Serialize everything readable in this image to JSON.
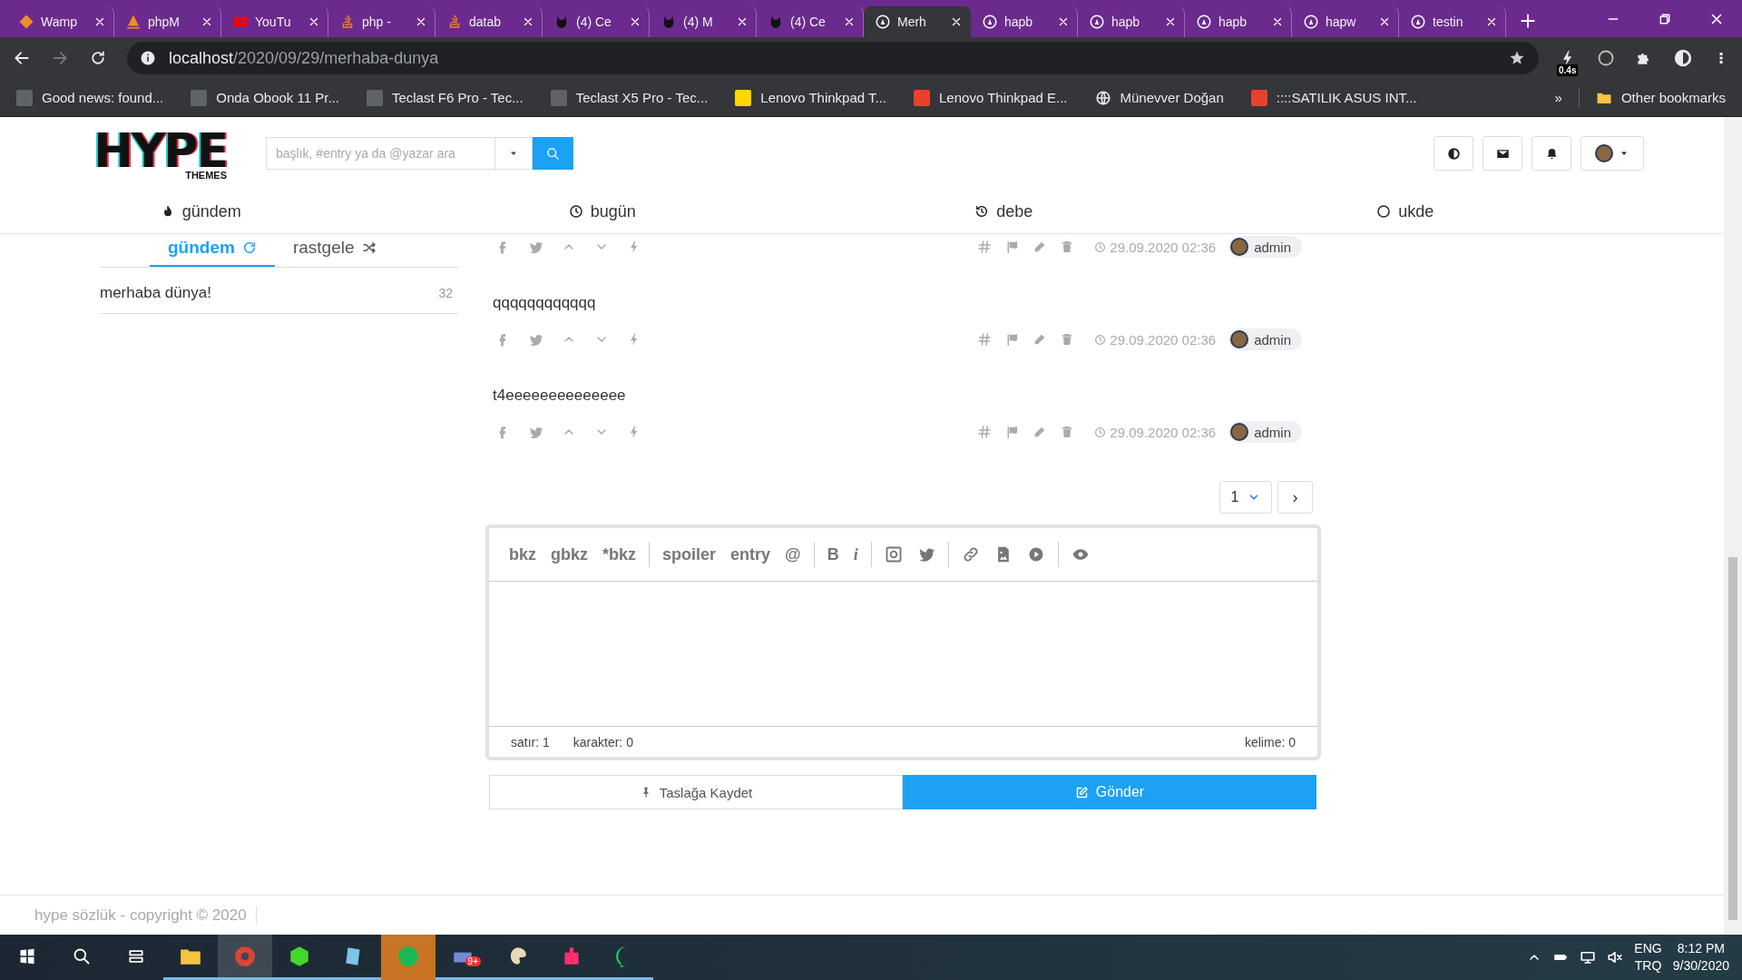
{
  "browser": {
    "tabs": [
      {
        "title": "Wamp",
        "kind": "diamond",
        "selected": false
      },
      {
        "title": "phpM",
        "kind": "sail",
        "selected": false
      },
      {
        "title": "YouTu",
        "kind": "play",
        "selected": false
      },
      {
        "title": "php -",
        "kind": "stack",
        "selected": false
      },
      {
        "title": "datab",
        "kind": "stack",
        "selected": false
      },
      {
        "title": "(4) Ce",
        "kind": "figure",
        "selected": false
      },
      {
        "title": "(4) M",
        "kind": "figure",
        "selected": false
      },
      {
        "title": "(4) Ce",
        "kind": "figure",
        "selected": false
      },
      {
        "title": "Merh",
        "kind": "ring",
        "selected": true
      },
      {
        "title": "hapb",
        "kind": "ring",
        "selected": false
      },
      {
        "title": "hapb",
        "kind": "ring",
        "selected": false
      },
      {
        "title": "hapb",
        "kind": "ring",
        "selected": false
      },
      {
        "title": "hapw",
        "kind": "ring",
        "selected": false
      },
      {
        "title": "testin",
        "kind": "ring",
        "selected": false
      }
    ],
    "address": {
      "host": "localhost",
      "path": "/2020/09/29/merhaba-dunya"
    },
    "extension_badge": "0.4s",
    "bookmarks": [
      {
        "label": "Good news: found...",
        "kind": "grey"
      },
      {
        "label": "Onda Obook 11 Pr...",
        "kind": "grey"
      },
      {
        "label": "Teclast F6 Pro - Tec...",
        "kind": "grey"
      },
      {
        "label": "Teclast X5 Pro - Tec...",
        "kind": "grey"
      },
      {
        "label": "Lenovo Thinkpad T...",
        "kind": "yellow"
      },
      {
        "label": "Lenovo Thinkpad E...",
        "kind": "red"
      },
      {
        "label": "Münevver Doğan",
        "kind": "globe"
      },
      {
        "label": "::::SATILIK ASUS INT...",
        "kind": "red"
      }
    ],
    "bookmarks_overflow": "»",
    "other_bookmarks": "Other bookmarks"
  },
  "site": {
    "logo": {
      "title": "HYPE",
      "subtitle": "THEMES"
    },
    "search": {
      "placeholder": "başlık, #entry ya da @yazar ara"
    },
    "nav": [
      {
        "label": "gündem",
        "kind": "fire"
      },
      {
        "label": "bugün",
        "kind": "clock"
      },
      {
        "label": "debe",
        "kind": "history"
      },
      {
        "label": "ukde",
        "kind": "circle"
      }
    ],
    "sidebar": {
      "tabs": [
        {
          "label": "gündem",
          "kind": "refresh",
          "selected": true
        },
        {
          "label": "rastgele",
          "kind": "shuffle",
          "selected": false
        }
      ],
      "topics": [
        {
          "title": "merhaba dünya!",
          "count": "32"
        }
      ]
    },
    "entries": [
      {
        "date": "29.09.2020 02:36",
        "author": "admin"
      },
      {
        "text": "qqqqqqqqqqqq",
        "date": "29.09.2020 02:36",
        "author": "admin"
      },
      {
        "text": "t4eeeeeeeeeeeeee",
        "date": "29.09.2020 02:36",
        "author": "admin"
      }
    ],
    "pagination": {
      "page": "1",
      "next": "›"
    },
    "editor": {
      "toolbar": [
        [
          {
            "kind": "text",
            "label": "bkz"
          },
          {
            "kind": "text",
            "label": "gbkz"
          },
          {
            "kind": "text",
            "label": "*bkz"
          }
        ],
        [
          {
            "kind": "text",
            "label": "spoiler"
          },
          {
            "kind": "text",
            "label": "entry"
          },
          {
            "kind": "text",
            "label": "@"
          }
        ],
        [
          {
            "kind": "text",
            "label": "B"
          },
          {
            "kind": "italic",
            "label": "i"
          }
        ],
        [
          {
            "kind": "camera"
          },
          {
            "kind": "bird"
          }
        ],
        [
          {
            "kind": "link"
          },
          {
            "kind": "image"
          },
          {
            "kind": "play"
          }
        ],
        [
          {
            "kind": "eye"
          }
        ]
      ],
      "status": {
        "lines": "satır: 1",
        "chars": "karakter: 0",
        "words": "kelime: 0"
      },
      "save_button": "Taslağa Kaydet",
      "send_button": "Gönder"
    },
    "footer": "hype sözlük - copyright © 2020"
  },
  "taskbar": {
    "apps": [
      {
        "kind": "folder",
        "selected": false,
        "attention": false
      },
      {
        "kind": "chrome",
        "selected": true,
        "attention": false
      },
      {
        "kind": "snake",
        "selected": false,
        "attention": false
      },
      {
        "kind": "notepad",
        "selected": false,
        "attention": false
      },
      {
        "kind": "music",
        "selected": false,
        "attention": true
      },
      {
        "kind": "gamepad",
        "selected": false,
        "attention": false,
        "badge": "9+"
      },
      {
        "kind": "palette",
        "selected": false,
        "attention": false
      },
      {
        "kind": "robot",
        "selected": false,
        "attention": false
      },
      {
        "kind": "chat",
        "selected": false,
        "attention": false
      }
    ],
    "language": "ENG",
    "layout": "TRQ",
    "time": "8:12 PM",
    "date": "9/30/2020"
  }
}
